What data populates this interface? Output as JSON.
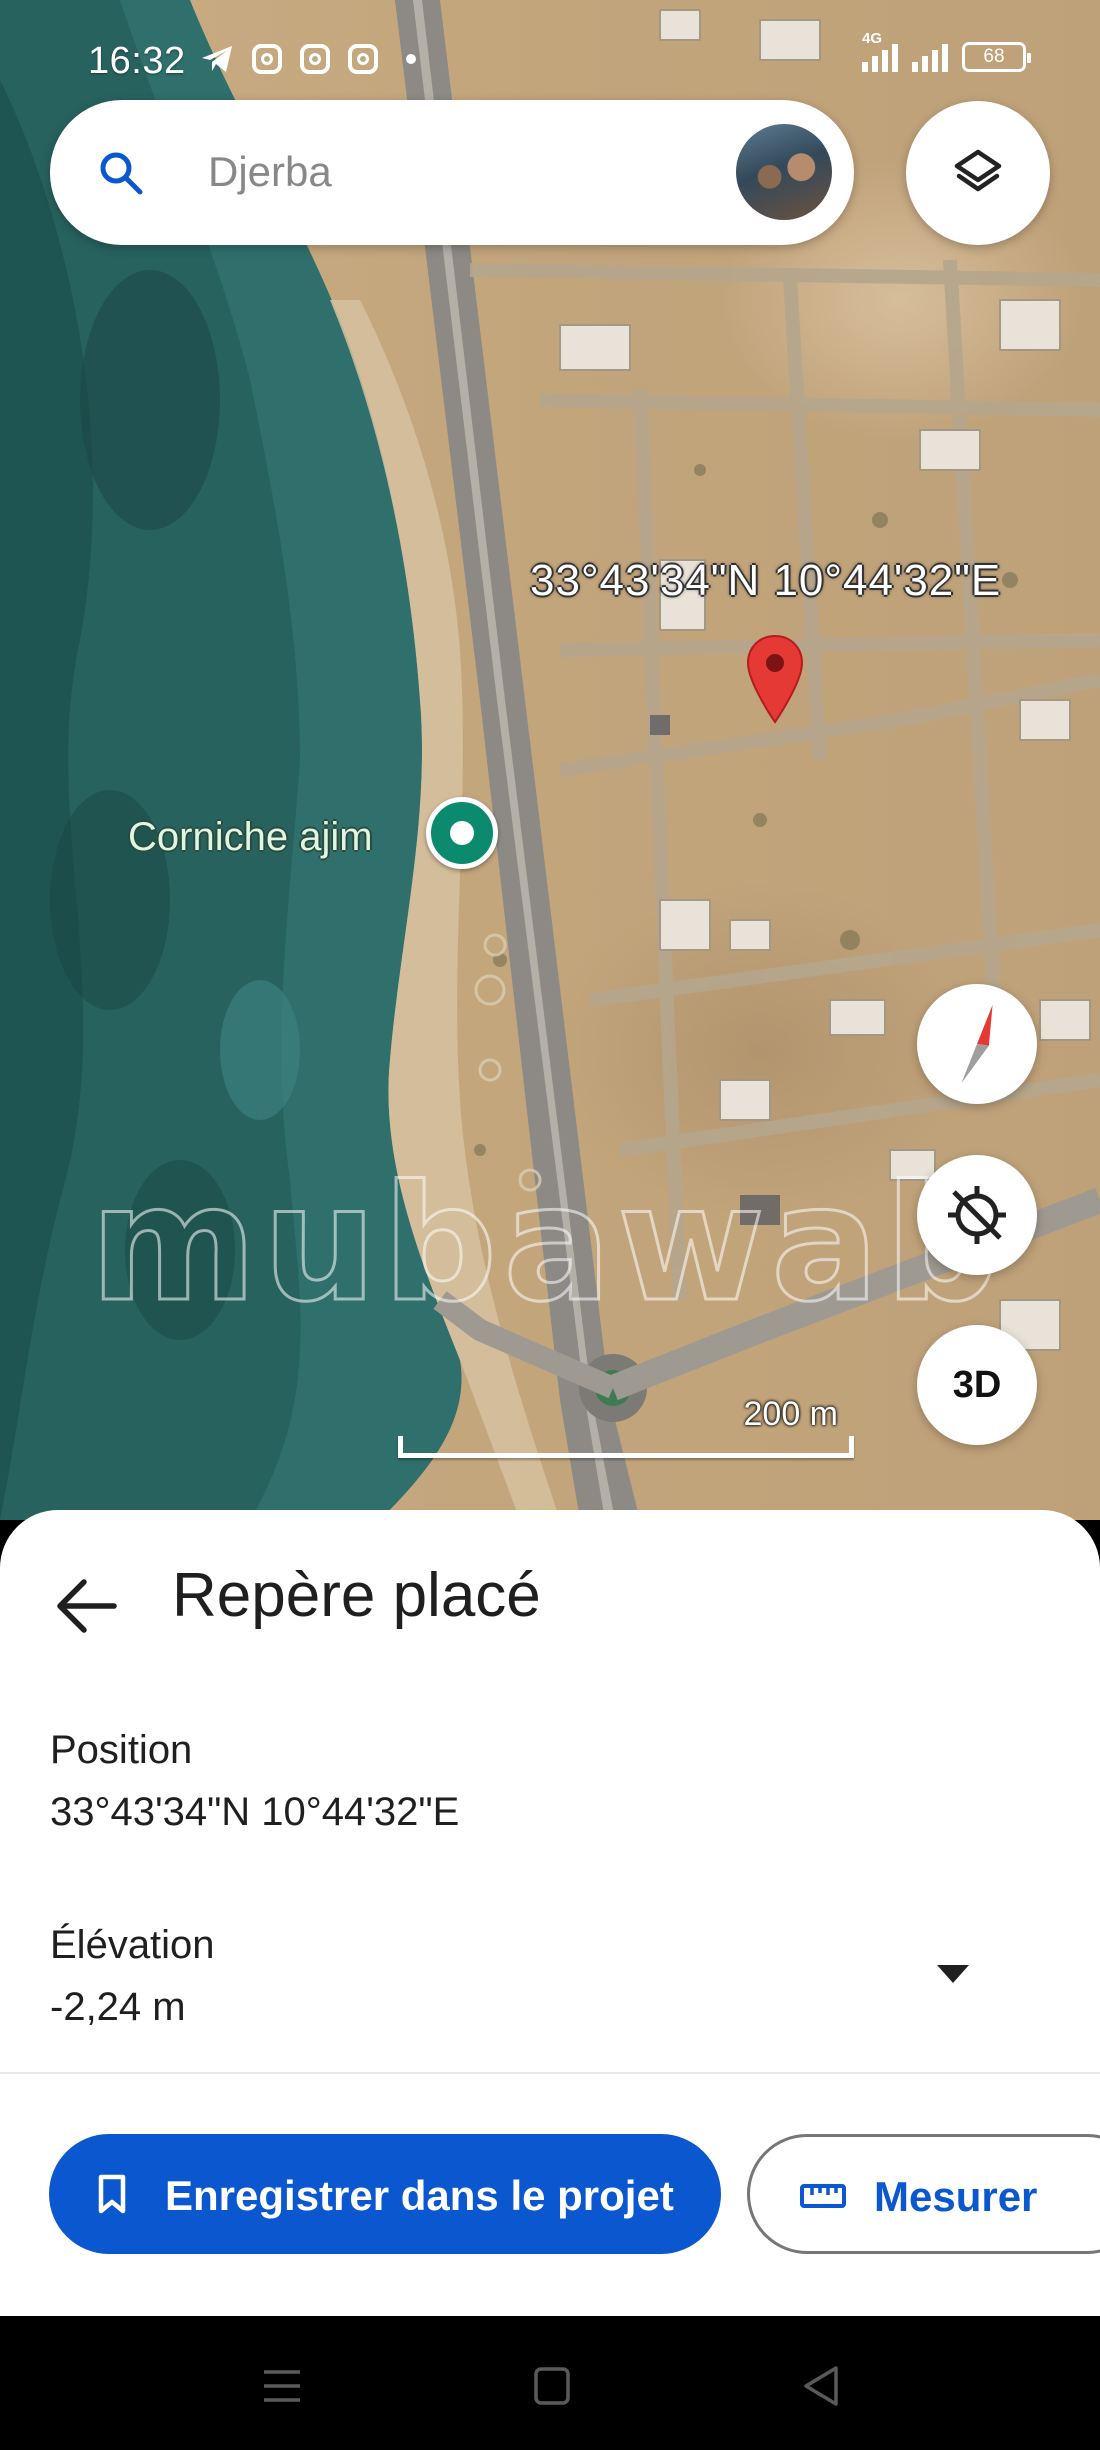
{
  "status_bar": {
    "time": "16:32",
    "network": "4G",
    "battery": "68"
  },
  "search": {
    "query": "Djerba"
  },
  "map": {
    "marker_coordinates": "33°43'34\"N 10°44'32\"E",
    "place_label": "Corniche ajim",
    "watermark": "mubawab",
    "scale_label": "200 m",
    "compass_label": "",
    "three_d_label": "3D"
  },
  "sheet": {
    "title": "Repère placé",
    "position_label": "Position",
    "position_value": "33°43'34\"N 10°44'32\"E",
    "elevation_label": "Élévation",
    "elevation_value": "-2,24 m",
    "save_button": "Enregistrer dans le projet",
    "measure_button": "Mesurer"
  },
  "colors": {
    "primary": "#0b57d0",
    "place_pin": "#0b8a6e",
    "marker": "#e53935"
  }
}
